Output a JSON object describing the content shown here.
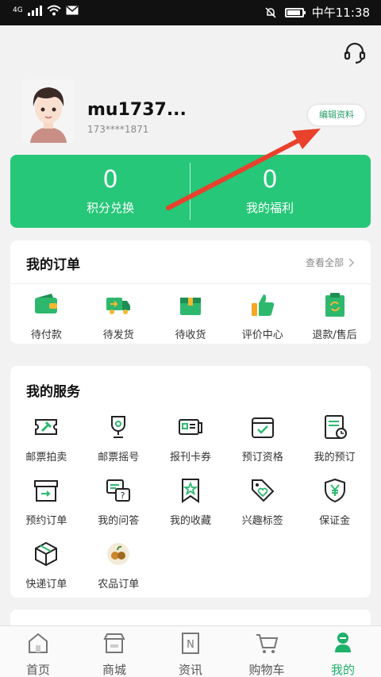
{
  "status_bar": {
    "network": "4G",
    "time": "中午11:38"
  },
  "profile": {
    "username": "mu1737...",
    "phone": "173****1871",
    "edit_label": "编辑资料"
  },
  "stats": [
    {
      "value": "0",
      "label": "积分兑换"
    },
    {
      "value": "0",
      "label": "我的福利"
    }
  ],
  "orders": {
    "title": "我的订单",
    "view_all": "查看全部",
    "items": [
      {
        "label": "待付款",
        "icon": "wallet-icon"
      },
      {
        "label": "待发货",
        "icon": "truck-icon"
      },
      {
        "label": "待收货",
        "icon": "box-icon"
      },
      {
        "label": "评价中心",
        "icon": "thumbs-up-icon"
      },
      {
        "label": "退款/售后",
        "icon": "refund-clipboard-icon"
      }
    ]
  },
  "services": {
    "title": "我的服务",
    "items": [
      {
        "label": "邮票拍卖",
        "icon": "auction-icon"
      },
      {
        "label": "邮票摇号",
        "icon": "trophy-icon"
      },
      {
        "label": "报刊卡券",
        "icon": "card-icon"
      },
      {
        "label": "预订资格",
        "icon": "calendar-check-icon"
      },
      {
        "label": "我的预订",
        "icon": "document-clock-icon"
      },
      {
        "label": "预约订单",
        "icon": "archive-icon"
      },
      {
        "label": "我的问答",
        "icon": "qa-icon"
      },
      {
        "label": "我的收藏",
        "icon": "bookmark-star-icon"
      },
      {
        "label": "兴趣标签",
        "icon": "tag-heart-icon"
      },
      {
        "label": "保证金",
        "icon": "shield-yen-icon"
      },
      {
        "label": "快递订单",
        "icon": "package-icon"
      },
      {
        "label": "农品订单",
        "icon": "farm-produce-icon"
      }
    ]
  },
  "tabs": [
    {
      "label": "首页",
      "icon": "home-icon"
    },
    {
      "label": "商城",
      "icon": "store-icon"
    },
    {
      "label": "资讯",
      "icon": "news-icon"
    },
    {
      "label": "购物车",
      "icon": "cart-icon"
    },
    {
      "label": "我的",
      "icon": "user-icon"
    }
  ],
  "colors": {
    "brand_green": "#26c778",
    "accent_red": "#e8412c",
    "active_tab": "#1fb06a"
  }
}
